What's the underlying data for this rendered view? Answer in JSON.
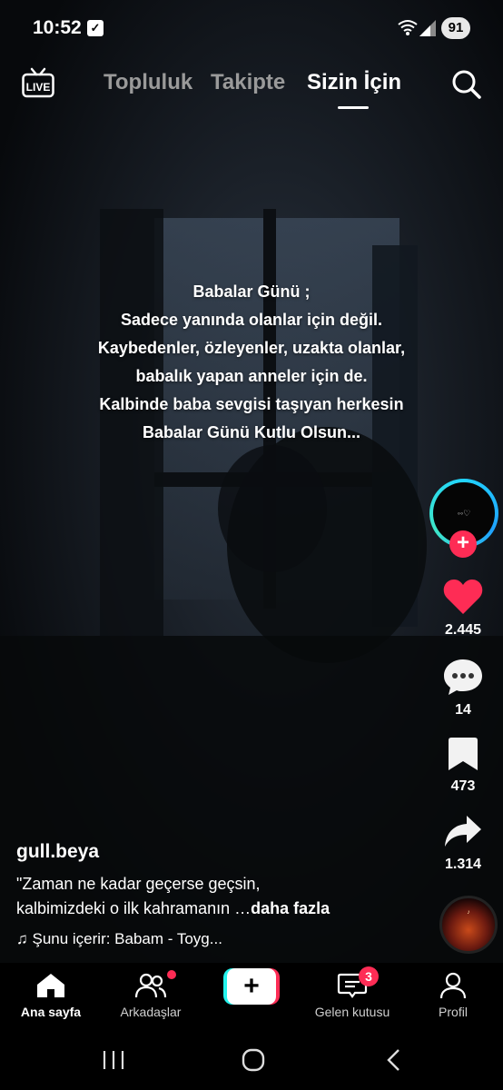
{
  "status_bar": {
    "time": "10:52",
    "battery": "91"
  },
  "top_nav": {
    "live_label": "LIVE",
    "tabs": [
      {
        "label": "Topluluk"
      },
      {
        "label": "Takipte"
      },
      {
        "label": "Sizin İçin"
      }
    ]
  },
  "video": {
    "caption_lines": [
      "Babalar Günü ;",
      "Sadece yanında olanlar için değil.",
      "Kaybedenler,  özleyenler,  uzakta olanlar,",
      "babalık yapan anneler için de.",
      "Kalbinde baba sevgisi taşıyan herkesin",
      "Babalar Günü Kutlu Olsun..."
    ]
  },
  "actions": {
    "likes": "2.445",
    "comments": "14",
    "saves": "473",
    "shares": "1.314"
  },
  "post": {
    "author": "gull.beya",
    "description_line1": "\"Zaman ne kadar geçerse geçsin,",
    "description_line2": "kalbimizdeki o ilk kahramanın …",
    "more": "daha fazla",
    "music": "Şunu içerir: Babam - Toyg..."
  },
  "bottom_nav": {
    "home": "Ana sayfa",
    "friends": "Arkadaşlar",
    "inbox": "Gelen kutusu",
    "inbox_badge": "3",
    "profile": "Profil"
  },
  "colors": {
    "accent": "#fe2c55",
    "cyan": "#25f4ee"
  }
}
